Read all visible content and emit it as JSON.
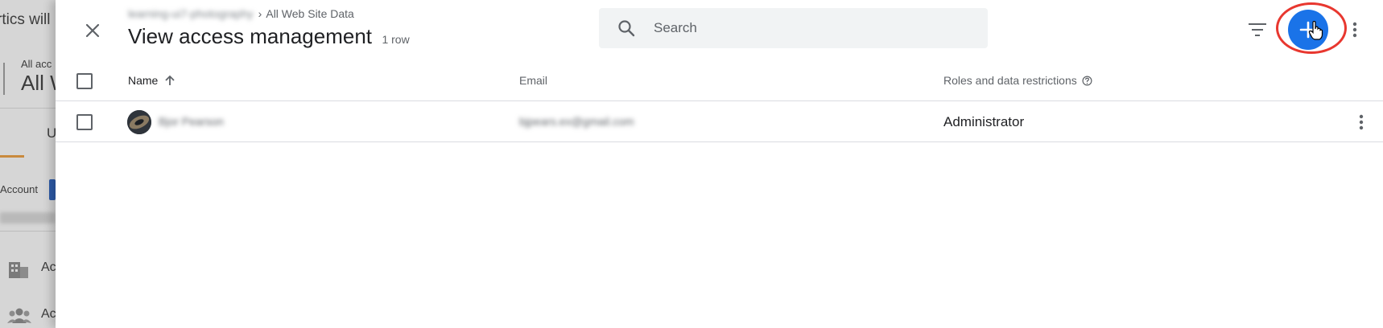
{
  "background": {
    "title_fragment": "rtics will",
    "account_small": "All acc",
    "account_big": "All W",
    "tab_fragment": "U",
    "account_label": "Account",
    "nav_item_1": "Ac",
    "nav_item_2": "Ac"
  },
  "header": {
    "breadcrumb_blurred": "learning-ui7-photography",
    "breadcrumb_separator": "›",
    "breadcrumb_current": "All Web Site Data",
    "title": "View access management",
    "row_count": "1 row",
    "close_icon": "close-icon"
  },
  "search": {
    "placeholder": "Search",
    "value": "",
    "icon": "search-icon"
  },
  "toolbar": {
    "filter_icon": "filter-icon",
    "add_icon": "plus-icon",
    "more_icon": "more-vert-icon",
    "accent_color": "#1a73e8",
    "highlight_color": "#e8372f"
  },
  "table": {
    "columns": [
      {
        "label": "Name",
        "sort": "ascending"
      },
      {
        "label": "Email"
      },
      {
        "label": "Roles and data restrictions"
      }
    ],
    "rows": [
      {
        "name": "Bjor Pearson",
        "email": "bjpears.ex@gmail.com",
        "role": "Administrator"
      }
    ]
  }
}
